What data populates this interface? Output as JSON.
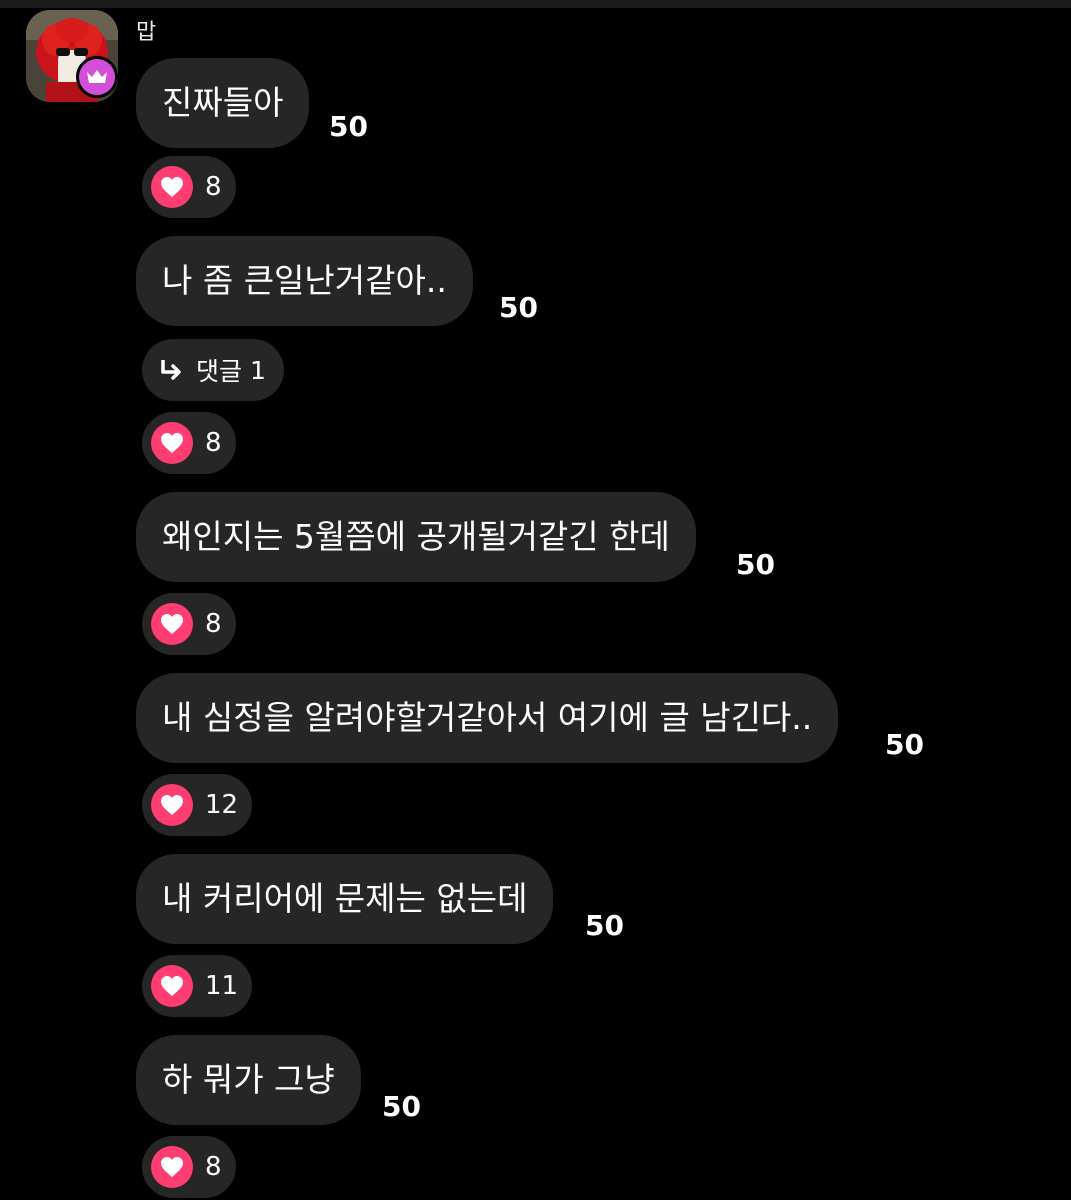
{
  "header": {
    "username": "맙",
    "avatar_badge": "crown-icon"
  },
  "colors": {
    "background": "#000000",
    "bubble": "#262626",
    "heart": "#ff3d71",
    "badge": "#d44fd9"
  },
  "messages": [
    {
      "text": "진짜들아",
      "count": "50",
      "likes": "8"
    },
    {
      "text": "나 좀 큰일난거같아..",
      "count": "50",
      "replies_label": "댓글",
      "replies_count": "1",
      "likes": "8"
    },
    {
      "text": "왜인지는 5월쯤에 공개될거같긴 한데",
      "count": "50",
      "likes": "8"
    },
    {
      "text": "내 심정을 알려야할거같아서 여기에 글 남긴다..",
      "count": "50",
      "likes": "12"
    },
    {
      "text": "내 커리어에 문제는 없는데",
      "count": "50",
      "likes": "11"
    },
    {
      "text": "하 뭐가 그냥",
      "count": "50",
      "likes": "8"
    }
  ]
}
